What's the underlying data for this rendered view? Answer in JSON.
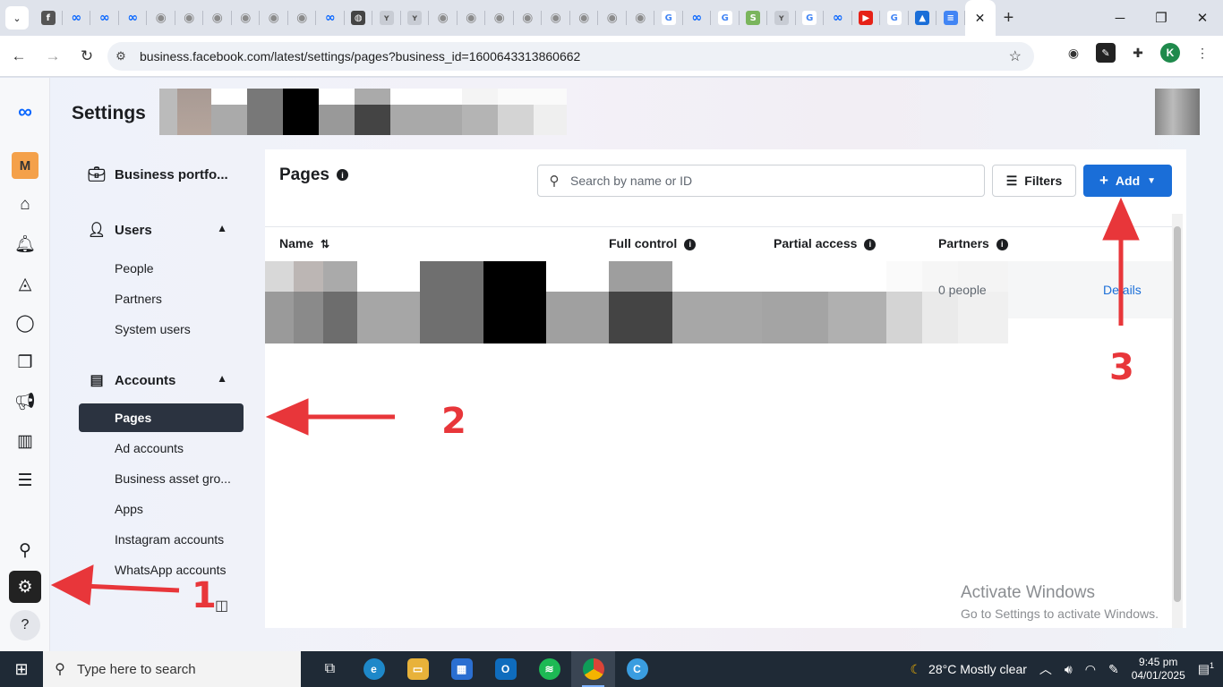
{
  "browser": {
    "tab_favicons": [
      "facebook-tab",
      "meta-tab",
      "meta-tab",
      "meta-tab",
      "camera-tab",
      "camera-tab",
      "camera-tab",
      "camera-tab",
      "camera-tab",
      "camera-tab",
      "meta-tab",
      "globe-tab",
      "y-tab",
      "y-tab",
      "camera-tab",
      "camera-tab",
      "camera-tab",
      "camera-tab",
      "camera-tab",
      "camera-tab",
      "camera-tab",
      "camera-tab",
      "google-tab",
      "meta-tab",
      "google-tab",
      "shopify-tab",
      "y-tab",
      "google-tab",
      "meta-tab",
      "youtube-tab",
      "google-tab",
      "lock-tab",
      "docs-tab"
    ],
    "url": "business.facebook.com/latest/settings/pages?business_id=1600643313860662",
    "profile_initial": "K"
  },
  "header": {
    "title": "Settings"
  },
  "rail": {
    "business_badge": "M"
  },
  "sidenav": {
    "business_portfolio": "Business portfo...",
    "users_heading": "Users",
    "users_items": [
      "People",
      "Partners",
      "System users"
    ],
    "accounts_heading": "Accounts",
    "accounts_items": [
      "Pages",
      "Ad accounts",
      "Business asset gro...",
      "Apps",
      "Instagram accounts",
      "WhatsApp accounts"
    ]
  },
  "main": {
    "title": "Pages",
    "search_placeholder": "Search by name or ID",
    "filters_label": "Filters",
    "add_label": "Add",
    "columns": {
      "name": "Name",
      "full_control": "Full control",
      "partial_access": "Partial access",
      "partners": "Partners"
    },
    "rows": [
      {
        "partners": "0 people",
        "action": "Details"
      }
    ]
  },
  "watermark": {
    "line1": "Activate Windows",
    "line2": "Go to Settings to activate Windows."
  },
  "annotations": [
    "1",
    "2",
    "3"
  ],
  "taskbar": {
    "search_placeholder": "Type here to search",
    "weather": "28°C  Mostly clear",
    "time": "9:45 pm",
    "date": "04/01/2025",
    "notification_count": "1"
  }
}
